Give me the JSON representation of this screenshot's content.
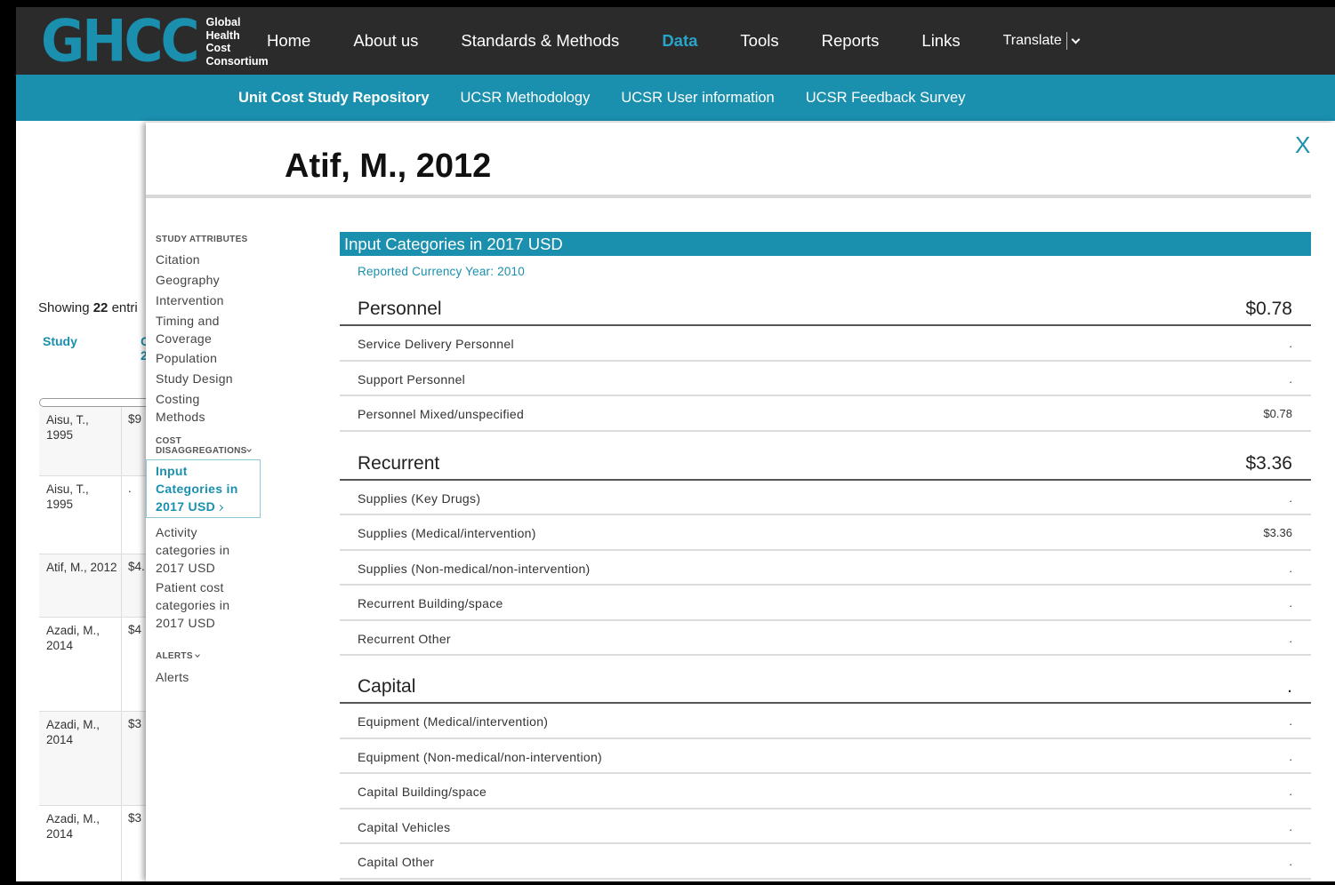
{
  "header": {
    "logo_mark": "GHCC",
    "logo_lines": [
      "Global",
      "Health",
      "Cost",
      "Consortium"
    ],
    "nav": [
      "Home",
      "About us",
      "Standards & Methods",
      "Data",
      "Tools",
      "Reports",
      "Links"
    ],
    "active_nav": "Data",
    "translate": "Translate"
  },
  "subnav": [
    "Unit Cost Study Repository",
    "UCSR Methodology",
    "UCSR User information",
    "UCSR Feedback Survey"
  ],
  "background_table": {
    "showing_prefix": "Showing ",
    "showing_count": "22",
    "showing_suffix": " entri",
    "col_study": "Study",
    "col_cost": "C\n2",
    "rows": [
      {
        "study": "Aisu, T., 1995",
        "cost": "$9"
      },
      {
        "study": "Aisu, T., 1995",
        "cost": "."
      },
      {
        "study": "Atif, M., 2012",
        "cost": "$4."
      },
      {
        "study": "Azadi, M., 2014",
        "cost": "$4"
      },
      {
        "study": "Azadi, M., 2014",
        "cost": "$3"
      },
      {
        "study": "Azadi, M., 2014",
        "cost": "$3"
      }
    ]
  },
  "modal": {
    "title": "Atif, M., 2012",
    "close": "X",
    "menu": {
      "study_attributes_head": "STUDY ATTRIBUTES",
      "study_attributes": [
        "Citation",
        "Geography",
        "Intervention",
        "Timing and Coverage",
        "Population",
        "Study Design",
        "Costing Methods"
      ],
      "cost_head": "COST DISAGGREGATIONS",
      "cost_items": [
        "Input Categories in 2017 USD",
        "Activity categories in 2017 USD",
        "Patient cost categories in 2017 USD"
      ],
      "alerts_head": "ALERTS",
      "alerts_items": [
        "Alerts"
      ]
    },
    "section_title": "Input Categories in 2017 USD",
    "reported_currency": "Reported Currency Year: 2010",
    "groups": [
      {
        "name": "Personnel",
        "value": "$0.78",
        "rows": [
          {
            "name": "Service Delivery Personnel",
            "value": "."
          },
          {
            "name": "Support Personnel",
            "value": "."
          },
          {
            "name": "Personnel Mixed/unspecified",
            "value": "$0.78"
          }
        ]
      },
      {
        "name": "Recurrent",
        "value": "$3.36",
        "rows": [
          {
            "name": "Supplies (Key Drugs)",
            "value": "."
          },
          {
            "name": "Supplies (Medical/intervention)",
            "value": "$3.36"
          },
          {
            "name": "Supplies (Non-medical/non-intervention)",
            "value": "."
          },
          {
            "name": "Recurrent Building/space",
            "value": "."
          },
          {
            "name": "Recurrent Other",
            "value": "."
          }
        ]
      },
      {
        "name": "Capital",
        "value": ".",
        "rows": [
          {
            "name": "Equipment (Medical/intervention)",
            "value": "."
          },
          {
            "name": "Equipment (Non-medical/non-intervention)",
            "value": "."
          },
          {
            "name": "Capital Building/space",
            "value": "."
          },
          {
            "name": "Capital Vehicles",
            "value": "."
          },
          {
            "name": "Capital Other",
            "value": "."
          }
        ]
      }
    ]
  }
}
